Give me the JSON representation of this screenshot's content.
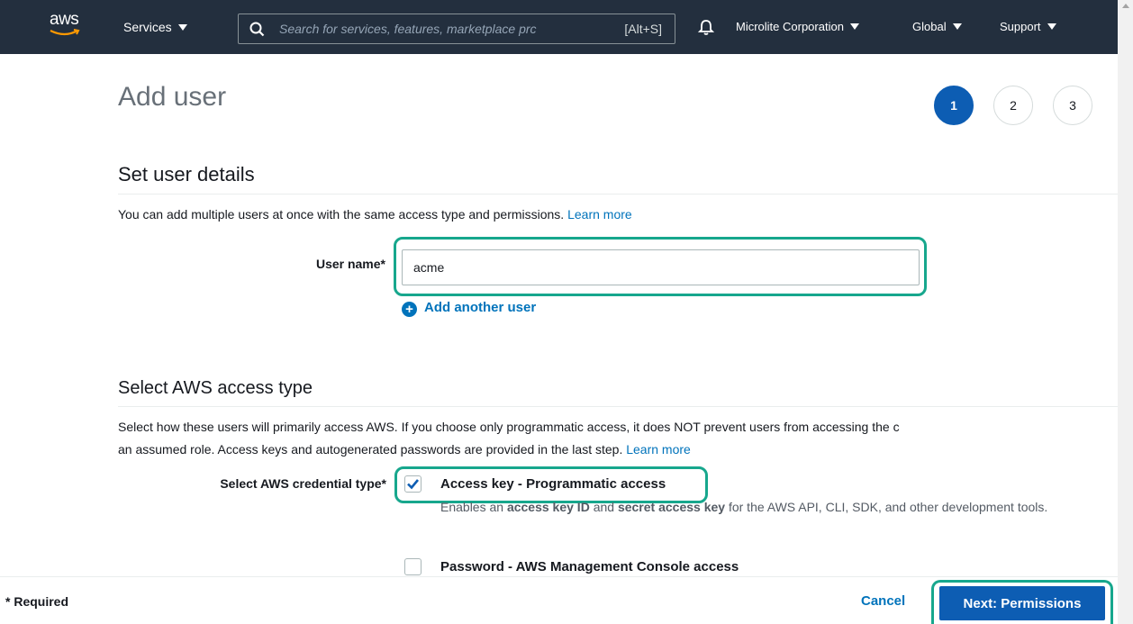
{
  "nav": {
    "logo_text": "aws",
    "services_label": "Services",
    "search_placeholder": "Search for services, features, marketplace prc",
    "search_shortcut": "[Alt+S]",
    "account_label": "Microlite Corporation",
    "region_label": "Global",
    "support_label": "Support"
  },
  "page": {
    "title": "Add user",
    "steps": [
      "1",
      "2",
      "3"
    ],
    "active_step": "1"
  },
  "user_details": {
    "title": "Set user details",
    "description": "You can add multiple users at once with the same access type and permissions.",
    "learn_more": "Learn more",
    "user_name_label": "User name*",
    "user_name_value": "acme",
    "add_another_label": "Add another user"
  },
  "access_type": {
    "title": "Select AWS access type",
    "description_line1": "Select how these users will primarily access AWS. If you choose only programmatic access, it does NOT prevent users from accessing the c",
    "description_line2": "an assumed role. Access keys and autogenerated passwords are provided in the last step.",
    "learn_more": "Learn more",
    "credential_label": "Select AWS credential type*",
    "options": [
      {
        "title": "Access key - Programmatic access",
        "checked": true,
        "desc_pre": "Enables an ",
        "desc_b1": "access key ID",
        "desc_mid": " and ",
        "desc_b2": "secret access key",
        "desc_post": " for the AWS API, CLI, SDK, and other development tools."
      },
      {
        "title": "Password - AWS Management Console access",
        "checked": false
      }
    ]
  },
  "footer": {
    "required_label": "* Required",
    "cancel_label": "Cancel",
    "next_label": "Next: Permissions"
  },
  "colors": {
    "nav_bg": "#232f3e",
    "primary": "#0d5db3",
    "link": "#0073bb",
    "highlight": "#17a78d"
  }
}
